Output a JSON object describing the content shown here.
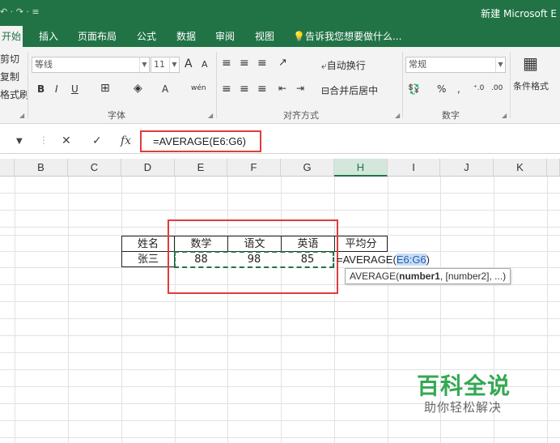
{
  "window": {
    "title": "新建 Microsoft E",
    "qat": "↶ · ↷ · ≡"
  },
  "tabs": [
    "开始",
    "插入",
    "页面布局",
    "公式",
    "数据",
    "审阅",
    "视图"
  ],
  "tell_me": "告诉我您想要做什么...",
  "clipboard": {
    "cut": "剪切",
    "copy": "复制",
    "painter": "格式刷"
  },
  "font": {
    "name": "等线",
    "size": "11",
    "bold": "B",
    "italic": "I",
    "underline": "U",
    "grow": "A",
    "shrink": "A",
    "phonetic": "wén",
    "group_label": "字体"
  },
  "alignment": {
    "wrap": "自动换行",
    "merge": "合并后居中",
    "group_label": "对齐方式"
  },
  "number": {
    "format": "常规",
    "percent": "%",
    "comma": ",",
    "group_label": "数字"
  },
  "styles": {
    "conditional": "条件格式"
  },
  "formula_bar": {
    "cancel": "✕",
    "enter": "✓",
    "fx": "fx",
    "formula": "=AVERAGE(E6:G6)"
  },
  "columns": [
    "B",
    "C",
    "D",
    "E",
    "F",
    "G",
    "H",
    "I",
    "J",
    "K"
  ],
  "table": {
    "headers": [
      "姓名",
      "数学",
      "语文",
      "英语",
      "平均分"
    ],
    "row": [
      "张三",
      "88",
      "98",
      "85"
    ]
  },
  "edit": {
    "prefix": "=AVERAGE(",
    "ref": "E6:G6",
    "suffix": ")"
  },
  "tooltip": {
    "fn": "AVERAGE(",
    "arg1": "number1",
    "rest": ", [number2], ...)"
  },
  "watermark": {
    "main": "百科全说",
    "sub": "助你轻松解决"
  },
  "colors": {
    "excel_green": "#217346",
    "highlight_red": "#e03c3c"
  }
}
